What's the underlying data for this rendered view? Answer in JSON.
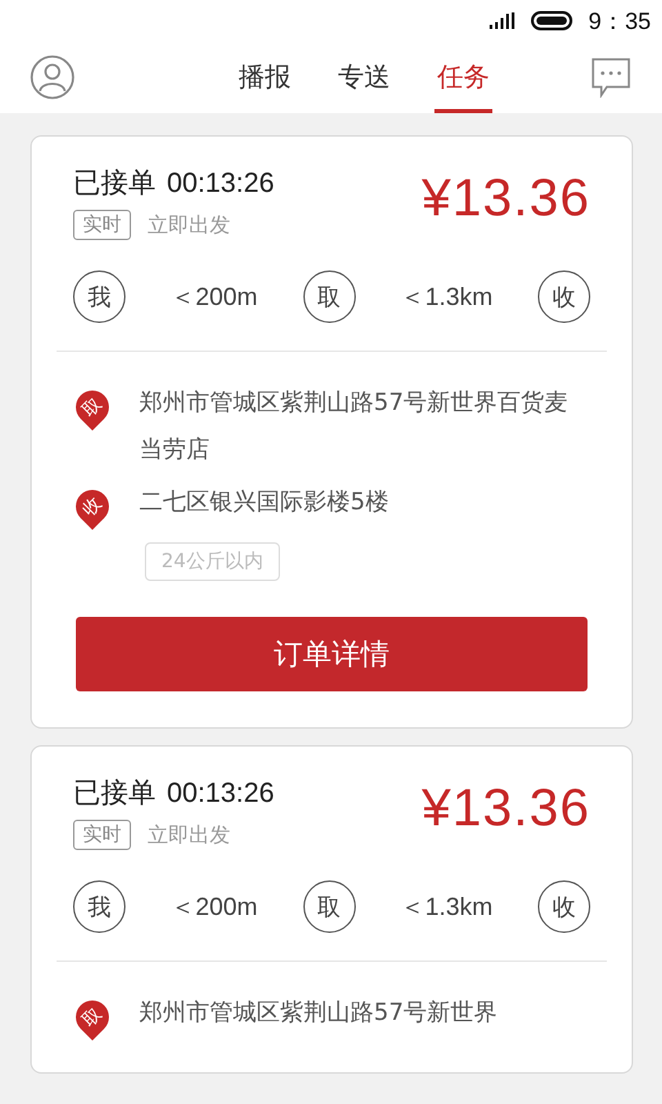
{
  "status_bar": {
    "time": "9：35"
  },
  "header": {
    "tabs": [
      {
        "label": "播报",
        "selected": false
      },
      {
        "label": "专送",
        "selected": false
      },
      {
        "label": "任务",
        "selected": true
      }
    ]
  },
  "orders": [
    {
      "status": "已接单",
      "timer": "00:13:26",
      "price": "¥13.36",
      "tag": "实时",
      "departure": "立即出发",
      "route": [
        {
          "kind": "node",
          "text": "我"
        },
        {
          "kind": "distance",
          "text": "＜200m"
        },
        {
          "kind": "node",
          "text": "取"
        },
        {
          "kind": "distance",
          "text": "＜1.3km"
        },
        {
          "kind": "node",
          "text": "收"
        }
      ],
      "stops": [
        {
          "marker": "取",
          "address": "郑州市管城区紫荆山路57号新世界百货麦当劳店"
        },
        {
          "marker": "收",
          "address": "二七区银兴国际影楼5楼"
        }
      ],
      "weight": "24公斤以内",
      "button": "订单详情"
    },
    {
      "status": "已接单",
      "timer": "00:13:26",
      "price": "¥13.36",
      "tag": "实时",
      "departure": "立即出发",
      "route": [
        {
          "kind": "node",
          "text": "我"
        },
        {
          "kind": "distance",
          "text": "＜200m"
        },
        {
          "kind": "node",
          "text": "取"
        },
        {
          "kind": "distance",
          "text": "＜1.3km"
        },
        {
          "kind": "node",
          "text": "收"
        }
      ],
      "stops": [
        {
          "marker": "取",
          "address": "郑州市管城区紫荆山路57号新世界"
        }
      ]
    }
  ]
}
